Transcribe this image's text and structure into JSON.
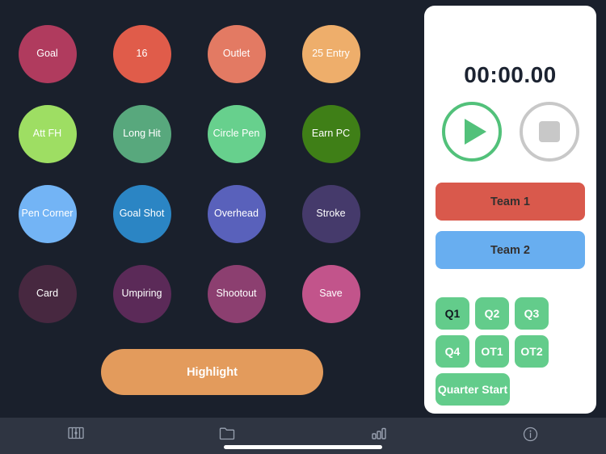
{
  "theme": {
    "background": "#1a202c",
    "tab_bar_background": "#2f3542",
    "panel_background": "#ffffff"
  },
  "action_grid": {
    "rows": [
      [
        {
          "label": "Goal",
          "color": "#b03b5e"
        },
        {
          "label": "16",
          "color": "#e05c4a"
        },
        {
          "label": "Outlet",
          "color": "#e37a63"
        },
        {
          "label": "25 Entry",
          "color": "#eeae6b"
        }
      ],
      [
        {
          "label": "Att FH",
          "color": "#9ede63"
        },
        {
          "label": "Long Hit",
          "color": "#58a87d"
        },
        {
          "label": "Circle Pen",
          "color": "#67d08d"
        },
        {
          "label": "Earn PC",
          "color": "#3f7f17"
        }
      ],
      [
        {
          "label": "Pen Corner",
          "color": "#73b4f5"
        },
        {
          "label": "Goal Shot",
          "color": "#2b85c4"
        },
        {
          "label": "Overhead",
          "color": "#5961bb"
        },
        {
          "label": "Stroke",
          "color": "#453a6b"
        }
      ],
      [
        {
          "label": "Card",
          "color": "#472840"
        },
        {
          "label": "Umpiring",
          "color": "#5b2a58"
        },
        {
          "label": "Shootout",
          "color": "#8c3f70"
        },
        {
          "label": "Save",
          "color": "#c2548b"
        }
      ]
    ],
    "highlight": {
      "label": "Highlight",
      "color": "#e39b5c"
    }
  },
  "control_panel": {
    "timer": "00:00.00",
    "play_icon": "play-icon",
    "stop_icon": "stop-icon",
    "teams": [
      {
        "label": "Team 1",
        "color": "#d9594c"
      },
      {
        "label": "Team 2",
        "color": "#68aef0"
      }
    ],
    "periods": [
      {
        "label": "Q1",
        "width": "w1",
        "active": true
      },
      {
        "label": "Q2",
        "width": "w1",
        "active": false
      },
      {
        "label": "Q3",
        "width": "w1",
        "active": false
      },
      {
        "label": "Q4",
        "width": "w1",
        "active": false
      },
      {
        "label": "OT1",
        "width": "w1",
        "active": false
      },
      {
        "label": "OT2",
        "width": "w1",
        "active": false
      },
      {
        "label": "Quarter Start",
        "width": "w3",
        "active": false
      }
    ],
    "period_color": "#63cc8b"
  },
  "tab_bar": {
    "items": [
      {
        "icon": "pitch-grid-icon"
      },
      {
        "icon": "folder-icon"
      },
      {
        "icon": "bar-chart-icon"
      },
      {
        "icon": "info-icon"
      }
    ]
  }
}
